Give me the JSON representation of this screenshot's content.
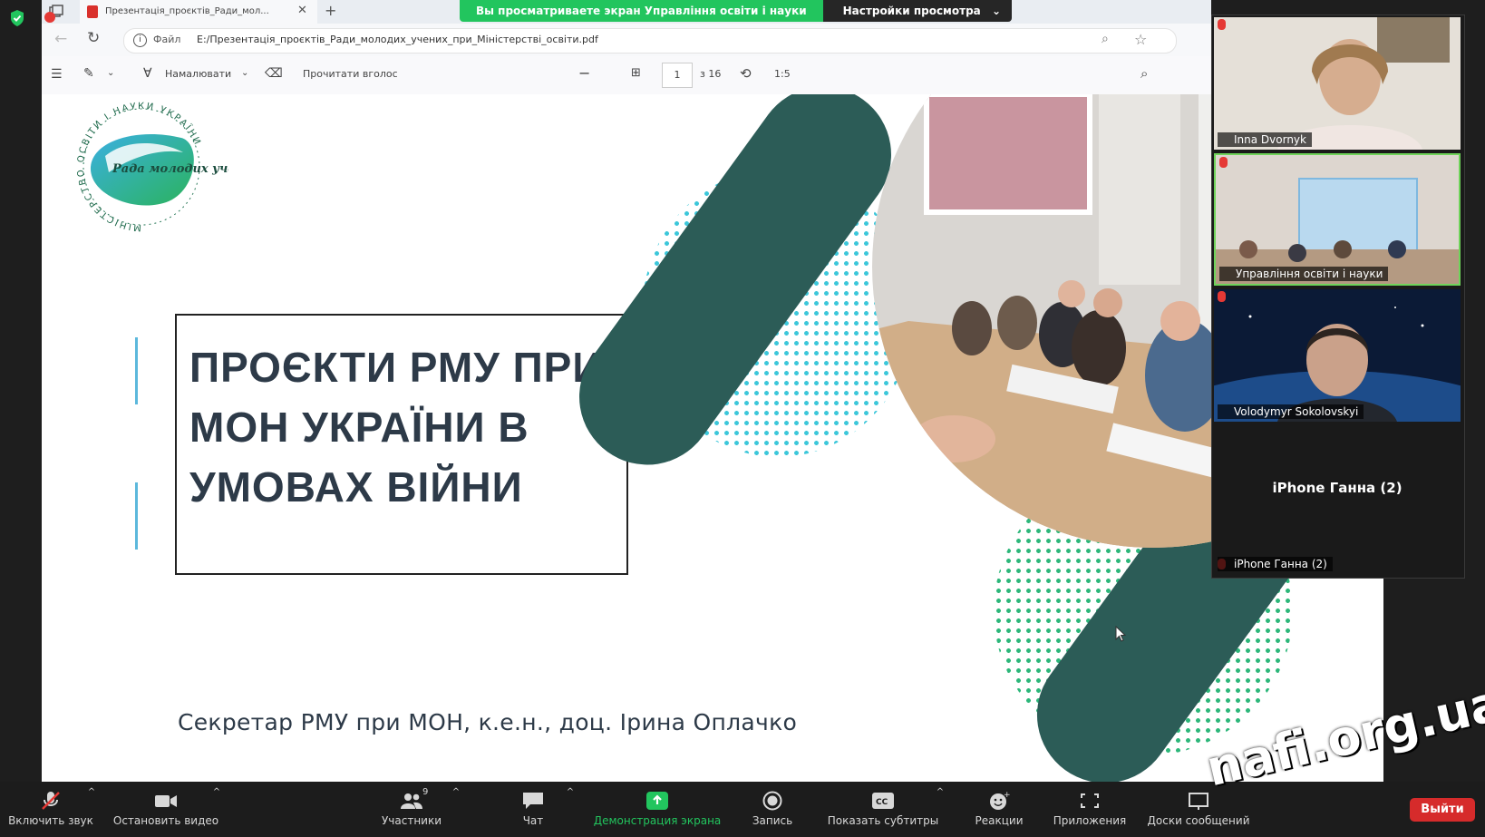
{
  "banner": {
    "text": "Вы просматриваете экран Управління освіти і науки",
    "options_label": "Настройки просмотра"
  },
  "browser": {
    "tab_title": "Презентація_проєктів_Ради_мол...",
    "address_prefix": "Файл",
    "address": "E:/Презентація_проєктів_Ради_молодих_учених_при_Міністерстві_освіти.pdf"
  },
  "pdf_toolbar": {
    "draw_label": "Намалювати",
    "read_aloud_label": "Прочитати вголос",
    "page_current": "1",
    "page_total": "з 16",
    "fit_label": "1:5"
  },
  "slide": {
    "logo_ring_text": "МІНІСТЕРСТВО ОСВІТИ І НАУКИ УКРАЇНИ",
    "logo_inner_text": "Рада молодих учених",
    "title": "ПРОЄКТИ РМУ ПРИ МОН УКРАЇНИ В УМОВАХ ВІЙНИ",
    "subtitle": "Секретар РМУ при МОН, к.е.н., доц. Ірина Оплачко"
  },
  "participants": [
    {
      "name": "Inna Dvornyk"
    },
    {
      "name": "Управління освіти і науки"
    },
    {
      "name": "Volodymyr Sokolovskyi"
    },
    {
      "name": "iPhone Ганна (2)",
      "video_off": true
    }
  ],
  "toolbar": {
    "mute": "Включить звук",
    "video": "Остановить видео",
    "participants": "Участники",
    "participants_count": "9",
    "chat": "Чат",
    "share": "Демонстрация экрана",
    "record": "Запись",
    "captions": "Показать субтитры",
    "reactions": "Реакции",
    "apps": "Приложения",
    "whiteboard": "Доски сообщений",
    "exit": "Выйти"
  },
  "watermark": "nafi.org.ua",
  "colors": {
    "share_green": "#22c55e",
    "title_text": "#2d3a48",
    "slide_teal_dark": "#2c5c57",
    "exit_red": "#d62b2b"
  }
}
